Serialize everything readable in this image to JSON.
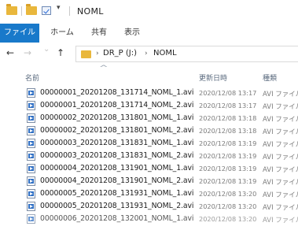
{
  "window": {
    "title": "NOML"
  },
  "quick_access": {
    "dropdown_glyph": "▾"
  },
  "ribbon": {
    "tabs": [
      "ファイル",
      "ホーム",
      "共有",
      "表示"
    ]
  },
  "nav": {
    "back_glyph": "←",
    "forward_glyph": "→",
    "recent_glyph": "⌄",
    "up_glyph": "↑"
  },
  "address": {
    "separator": "›",
    "path": [
      "DR_P (J:)",
      "NOML"
    ]
  },
  "columns": {
    "name": "名前",
    "modified": "更新日時",
    "type": "種類",
    "sort_glyph": "^"
  },
  "files": [
    {
      "name": "00000001_20201208_131714_NOML_1.avi",
      "modified": "2020/12/08 13:17",
      "type": "AVI ファイル"
    },
    {
      "name": "00000001_20201208_131714_NOML_2.avi",
      "modified": "2020/12/08 13:17",
      "type": "AVI ファイル"
    },
    {
      "name": "00000002_20201208_131801_NOML_1.avi",
      "modified": "2020/12/08 13:18",
      "type": "AVI ファイル"
    },
    {
      "name": "00000002_20201208_131801_NOML_2.avi",
      "modified": "2020/12/08 13:18",
      "type": "AVI ファイル"
    },
    {
      "name": "00000003_20201208_131831_NOML_1.avi",
      "modified": "2020/12/08 13:19",
      "type": "AVI ファイル"
    },
    {
      "name": "00000003_20201208_131831_NOML_2.avi",
      "modified": "2020/12/08 13:19",
      "type": "AVI ファイル"
    },
    {
      "name": "00000004_20201208_131901_NOML_1.avi",
      "modified": "2020/12/08 13:19",
      "type": "AVI ファイル"
    },
    {
      "name": "00000004_20201208_131901_NOML_2.avi",
      "modified": "2020/12/08 13:19",
      "type": "AVI ファイル"
    },
    {
      "name": "00000005_20201208_131931_NOML_1.avi",
      "modified": "2020/12/08 13:20",
      "type": "AVI ファイル"
    },
    {
      "name": "00000005_20201208_131931_NOML_2.avi",
      "modified": "2020/12/08 13:20",
      "type": "AVI ファイル"
    },
    {
      "name": "00000006_20201208_132001_NOML_1.avi",
      "modified": "2020/12/08 13:20",
      "type": "AVI ファイル"
    }
  ]
}
